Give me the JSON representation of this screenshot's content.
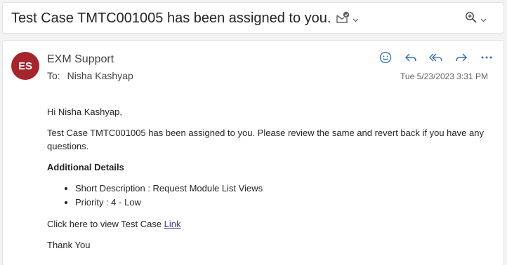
{
  "subject": "Test Case TMTC001005 has been assigned to you.",
  "subject_icons": [
    "mail-check-icon",
    "chevron-down-icon",
    "zoom-icon",
    "chevron-down-icon"
  ],
  "message": {
    "avatar_initials": "ES",
    "avatar_color": "#a4262c",
    "sender": "EXM Support",
    "to_label": "To:",
    "to_name": "Nisha Kashyap",
    "timestamp": "Tue 5/23/2023 3:31 PM",
    "actions": [
      "emoji-icon",
      "reply-icon",
      "reply-all-icon",
      "forward-icon",
      "more-icon"
    ],
    "body": {
      "greeting": "Hi Nisha Kashyap,",
      "paragraph": "Test Case TMTC001005 has been assigned to you. Please review the same and revert back if you have any questions.",
      "details_heading": "Additional Details",
      "details": [
        "Short Description : Request Module List Views",
        "Priority : 4 - Low"
      ],
      "link_prefix": "Click here to view Test Case ",
      "link_text": "Link",
      "closing": "Thank You"
    }
  },
  "accent_color": "#2b6cb0"
}
